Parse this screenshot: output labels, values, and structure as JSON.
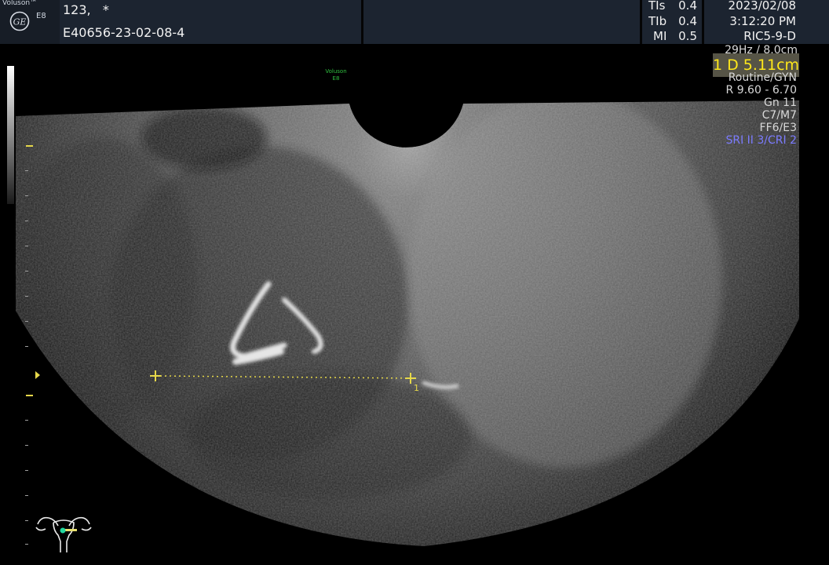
{
  "header": {
    "brand": "Voluson™",
    "model": "E8",
    "patient_name": "123,   *",
    "patient_id": "E40656-23-02-08-4",
    "indices": [
      {
        "label": "TIs",
        "value": "0.4"
      },
      {
        "label": "TIb",
        "value": "0.4"
      },
      {
        "label": "MI",
        "value": "0.5"
      }
    ],
    "date": "2023/02/08",
    "time": "3:12:20 PM",
    "probe": "RIC5-9-D"
  },
  "image": {
    "watermark_brand": "Voluson",
    "watermark_model": "E8",
    "frame_rate": "29Hz / 8.0cm",
    "measurement": "1 D 5.11cm",
    "caliper_number": "1",
    "params": [
      "Routine/GYN",
      "R 9.60 - 6.70",
      "Gn  11",
      "C7/M7",
      "FF6/E3",
      "SRI II 3/CRI 2"
    ],
    "colors": {
      "measurement": "#ffe81a",
      "sri": "#7b7bff",
      "watermark": "#2fbf3f",
      "header_bg": "#1c2430"
    }
  },
  "icons": {
    "logo": "ge-logo-icon",
    "body_marker": "uterus-icon",
    "focus": "focus-marker-icon",
    "caliper": "caliper-cross-icon"
  }
}
